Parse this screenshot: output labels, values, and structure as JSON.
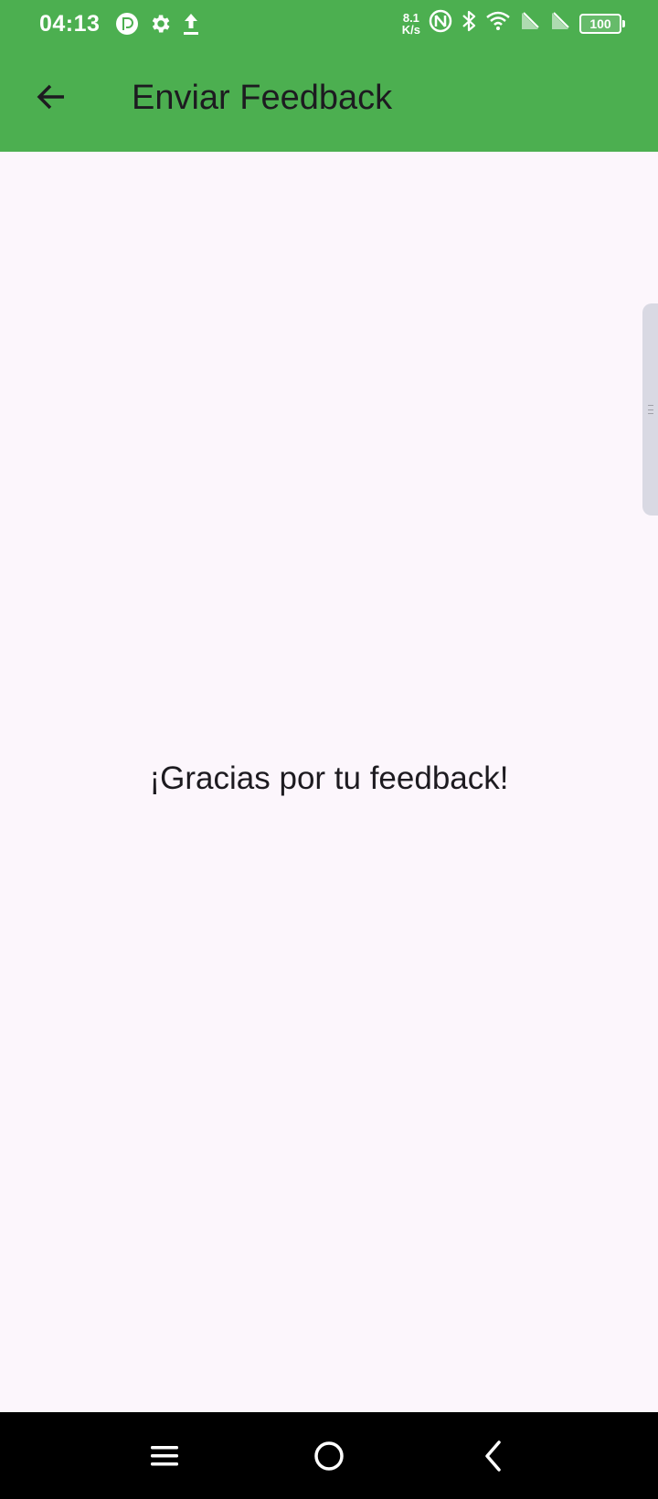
{
  "status_bar": {
    "time": "04:13",
    "net_speed_value": "8.1",
    "net_speed_unit": "K/s",
    "battery_level": "100",
    "left_icons": [
      "pocket-casts-icon",
      "settings-icon",
      "upload-icon"
    ],
    "right_icons": [
      "nfc-icon",
      "bluetooth-icon",
      "wifi-icon",
      "no-sim-icon",
      "no-sim-icon",
      "battery-icon"
    ]
  },
  "app_bar": {
    "title": "Enviar Feedback",
    "back_icon": "arrow-back-icon",
    "background_color": "#4caf50"
  },
  "main": {
    "message": "¡Gracias por tu feedback!",
    "background_color": "#fcf6fc"
  },
  "nav_bar": {
    "buttons": [
      "menu-icon",
      "home-icon",
      "back-icon"
    ]
  }
}
